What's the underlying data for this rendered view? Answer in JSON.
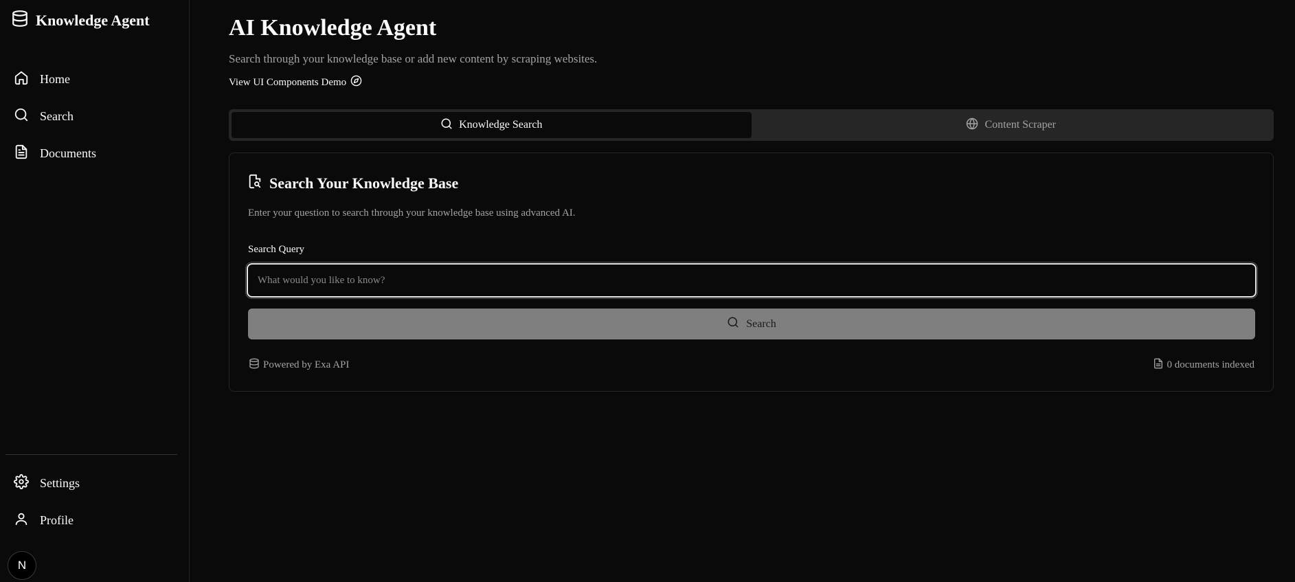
{
  "app": {
    "brand": "Knowledge Agent"
  },
  "sidebar": {
    "items": [
      {
        "label": "Home",
        "icon": "home-icon"
      },
      {
        "label": "Search",
        "icon": "search-icon"
      },
      {
        "label": "Documents",
        "icon": "document-icon"
      }
    ],
    "bottom_items": [
      {
        "label": "Settings",
        "icon": "gear-icon"
      },
      {
        "label": "Profile",
        "icon": "user-icon"
      }
    ],
    "badge": "N"
  },
  "header": {
    "title": "AI Knowledge Agent",
    "subtitle": "Search through your knowledge base or add new content by scraping websites.",
    "demo_link": "View UI Components Demo"
  },
  "tabs": [
    {
      "label": "Knowledge Search",
      "icon": "search-icon",
      "active": true
    },
    {
      "label": "Content Scraper",
      "icon": "globe-icon",
      "active": false
    }
  ],
  "card": {
    "title": "Search Your Knowledge Base",
    "description": "Enter your question to search through your knowledge base using advanced AI.",
    "field_label": "Search Query",
    "input_value": "",
    "input_placeholder": "What would you like to know?",
    "button_label": "Search",
    "footer_left": "Powered by Exa API",
    "footer_right": "0 documents indexed"
  },
  "colors": {
    "background": "#0a0a0a",
    "border": "#262626",
    "muted_text": "#a3a3a3",
    "button_disabled": "#7f7f7f"
  }
}
